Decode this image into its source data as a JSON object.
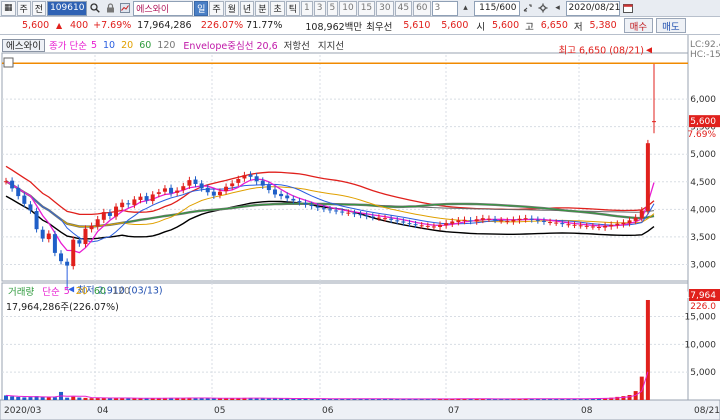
{
  "toolbar": {
    "buttons_left": [
      "▦",
      "주",
      "전"
    ],
    "stock_code": "109610",
    "stock_name": "에스와이",
    "period_tabs": [
      "일",
      "주",
      "월",
      "년",
      "분",
      "초",
      "틱"
    ],
    "selected_tab": "일",
    "intervals": [
      "1",
      "3",
      "5",
      "10",
      "15",
      "30",
      "45",
      "60"
    ],
    "interval_input": "3",
    "count_display": "115/600",
    "date": "2020/08/21"
  },
  "quote": {
    "price": "5,600",
    "change_arrow": "▲",
    "change": "400",
    "change_pct": "+7.69%",
    "volume": "17,964,286",
    "volume_ratio": "226.07%",
    "turnover": "71.77%",
    "amount": "108,962백만",
    "priority_label": "최우선",
    "best_ask": "5,610",
    "best_bid": "5,600",
    "open_label": "시",
    "open": "5,600",
    "high_label": "고",
    "high": "6,650",
    "low_label": "저",
    "low": "5,380",
    "buy_button": "매수",
    "sell_button": "매도"
  },
  "legend": {
    "name": "에스와이",
    "ma_label": "종가 단순",
    "ma_periods": [
      "5",
      "10",
      "20",
      "60",
      "120"
    ],
    "envelope": "Envelope중심선 20,6",
    "resistance": "저항선",
    "support": "지지선"
  },
  "annotations": {
    "high": "최고 6,650 (08/21)",
    "low": "최저 2,910 (03/13)",
    "lc": "LC:92.4",
    "hc": "HC:-15",
    "price_tag": "5,600",
    "pct_tag": "7.69%",
    "vol_tag": "17,964",
    "vol_pct_tag": "226.0"
  },
  "volume_legend": {
    "label": "거래량",
    "ma_label": "단순",
    "ma_periods": [
      "5",
      "20",
      "60",
      "120"
    ],
    "value": "17,964,286주(226.07%)"
  },
  "colors": {
    "up": "#e0201c",
    "down": "#1f5fc8",
    "ma5": "#e81ed2",
    "ma10": "#2b5fe0",
    "ma20": "#e0a000",
    "ma60": "#2e9a3c",
    "ma120": "#6a6a6a",
    "envelope": "#e0201c",
    "resistance": "#777777",
    "support": "#000000",
    "high_line": "#f08a00"
  },
  "chart_data": {
    "type": "candlestick",
    "price_axis_ticks": [
      "6,000",
      "5,500",
      "5,000",
      "4,500",
      "4,000",
      "3,500",
      "3,000"
    ],
    "volume_axis_ticks": [
      "15,000",
      "10,000",
      "5,000"
    ],
    "x_ticks": [
      "2020/03",
      "04",
      "05",
      "06",
      "07",
      "08",
      "08/21"
    ],
    "high": 6650,
    "low": 2910,
    "last": {
      "open": 5600,
      "high": 6650,
      "low": 5380,
      "close": 5600,
      "volume": 17964286
    },
    "closes": [
      4510,
      4380,
      4240,
      4100,
      3980,
      3640,
      3470,
      3560,
      3210,
      3060,
      2980,
      3450,
      3380,
      3650,
      3700,
      3820,
      3950,
      3880,
      4050,
      4120,
      4090,
      4180,
      4230,
      4160,
      4270,
      4310,
      4380,
      4290,
      4340,
      4420,
      4530,
      4460,
      4380,
      4310,
      4250,
      4320,
      4410,
      4470,
      4550,
      4620,
      4590,
      4510,
      4430,
      4350,
      4270,
      4240,
      4200,
      4160,
      4130,
      4090,
      4060,
      4030,
      4010,
      3990,
      3970,
      3950,
      3940,
      3920,
      3900,
      3880,
      3860,
      3850,
      3840,
      3810,
      3790,
      3760,
      3740,
      3720,
      3710,
      3700,
      3690,
      3720,
      3750,
      3780,
      3800,
      3810,
      3790,
      3820,
      3840,
      3830,
      3810,
      3800,
      3790,
      3810,
      3830,
      3840,
      3820,
      3800,
      3780,
      3770,
      3760,
      3740,
      3730,
      3720,
      3710,
      3700,
      3690,
      3680,
      3700,
      3720,
      3740,
      3760,
      3800,
      3850,
      3980,
      5200,
      5600
    ],
    "volumes": [
      820,
      640,
      560,
      470,
      520,
      700,
      560,
      480,
      510,
      1450,
      420,
      600,
      440,
      380,
      330,
      350,
      360,
      420,
      380,
      320,
      300,
      290,
      280,
      310,
      330,
      360,
      370,
      320,
      300,
      350,
      420,
      380,
      330,
      310,
      300,
      290,
      320,
      310,
      350,
      380,
      360,
      330,
      300,
      290,
      280,
      270,
      260,
      270,
      260,
      250,
      240,
      250,
      240,
      230,
      230,
      220,
      230,
      220,
      210,
      220,
      210,
      200,
      210,
      200,
      200,
      190,
      200,
      210,
      200,
      190,
      200,
      210,
      220,
      210,
      230,
      220,
      210,
      200,
      210,
      200,
      200,
      190,
      200,
      210,
      220,
      230,
      240,
      230,
      220,
      210,
      200,
      220,
      230,
      240,
      250,
      260,
      270,
      300,
      330,
      420,
      560,
      700,
      900,
      1600,
      4200,
      17964
    ]
  }
}
